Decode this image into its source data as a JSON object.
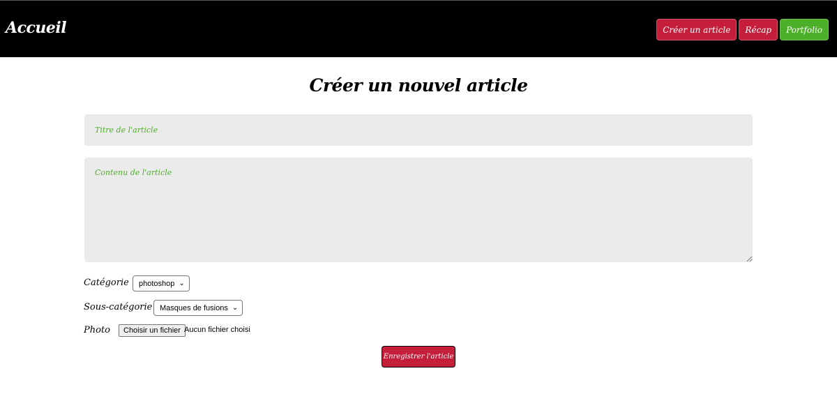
{
  "header": {
    "brand": "Accueil",
    "nav": [
      {
        "label": "Créer un article"
      },
      {
        "label": "Récap"
      },
      {
        "label": "Portfolio"
      }
    ]
  },
  "form": {
    "heading": "Créer un nouvel article",
    "title_placeholder": "Titre de l'article",
    "content_placeholder": "Contenu de l'article",
    "category_label": "Catégorie",
    "category_value": "photoshop",
    "subcategory_label": "Sous-catégorie",
    "subcategory_value": "Masques de fusions",
    "photo_label": "Photo",
    "file_button": "Choisir un fichier",
    "file_status": "Aucun fichier choisi",
    "submit": "Enregistrer l'article"
  },
  "colors": {
    "primary_red": "#c41e3a",
    "accent_green": "#4caf28",
    "header_bg": "#000000",
    "input_bg": "#ebebeb"
  }
}
